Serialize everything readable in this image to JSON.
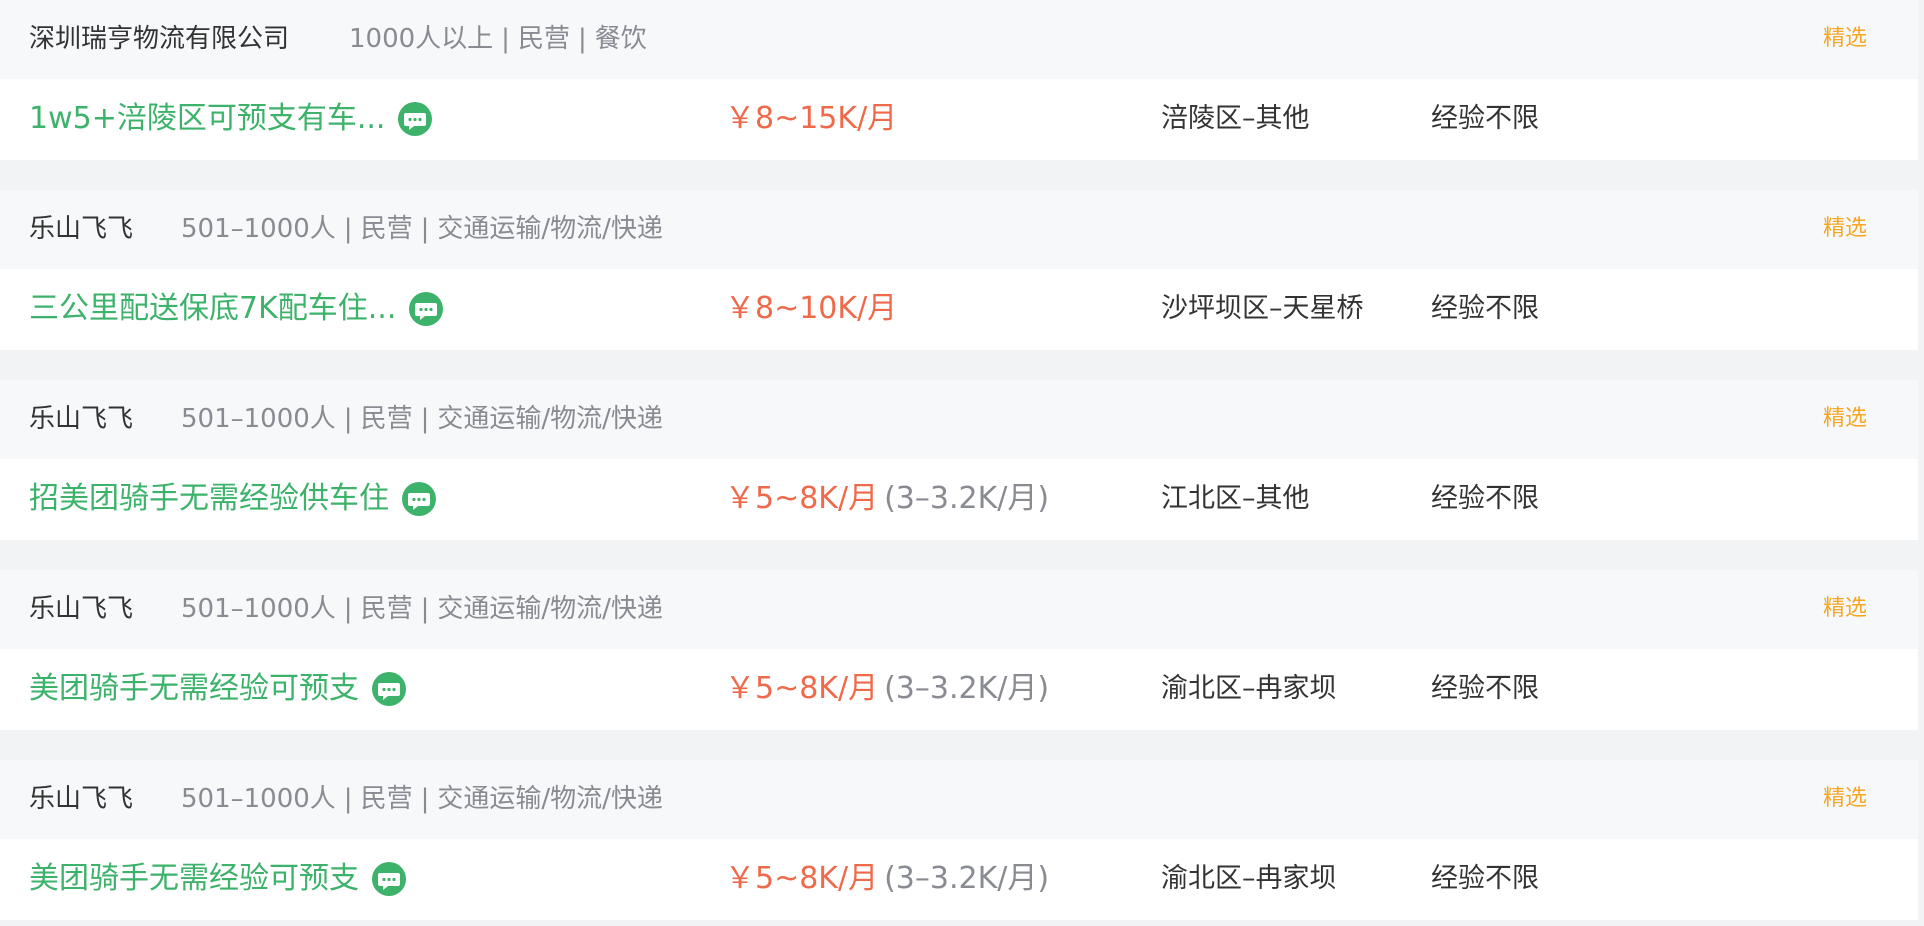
{
  "jobs": [
    {
      "company": "深圳瑞亨物流有限公司",
      "meta": [
        "1000人以上",
        "民营",
        "餐饮"
      ],
      "tag": "精选",
      "title": "1w5+涪陵区可预支有车...",
      "salary": "￥8~15K/月",
      "salary_sub": "",
      "location": "涪陵区–其他",
      "experience": "经验不限"
    },
    {
      "company": "乐山飞飞",
      "meta": [
        "501–1000人",
        "民营",
        "交通运输/物流/快递"
      ],
      "tag": "精选",
      "title": "三公里配送保底7K配车住...",
      "salary": "￥8~10K/月",
      "salary_sub": "",
      "location": "沙坪坝区–天星桥",
      "experience": "经验不限"
    },
    {
      "company": "乐山飞飞",
      "meta": [
        "501–1000人",
        "民营",
        "交通运输/物流/快递"
      ],
      "tag": "精选",
      "title": "招美团骑手无需经验供车住",
      "salary": "￥5~8K/月",
      "salary_sub": "(3–3.2K/月)",
      "location": "江北区–其他",
      "experience": "经验不限"
    },
    {
      "company": "乐山飞飞",
      "meta": [
        "501–1000人",
        "民营",
        "交通运输/物流/快递"
      ],
      "tag": "精选",
      "title": "美团骑手无需经验可预支",
      "salary": "￥5~8K/月",
      "salary_sub": "(3–3.2K/月)",
      "location": "渝北区–冉家坝",
      "experience": "经验不限"
    },
    {
      "company": "乐山飞飞",
      "meta": [
        "501–1000人",
        "民营",
        "交通运输/物流/快递"
      ],
      "tag": "精选",
      "title": "美团骑手无需经验可预支",
      "salary": "￥5~8K/月",
      "salary_sub": "(3–3.2K/月)",
      "location": "渝北区–冉家坝",
      "experience": "经验不限"
    }
  ],
  "icons": {
    "chat": "chat-bubble-icon"
  },
  "colors": {
    "title_green": "#3db26a",
    "salary_red": "#ef6a4a",
    "tag_orange": "#f5a623",
    "meta_gray": "#888b91",
    "company_bg": "#f7f8fa",
    "gap_bg": "#f2f3f5"
  }
}
